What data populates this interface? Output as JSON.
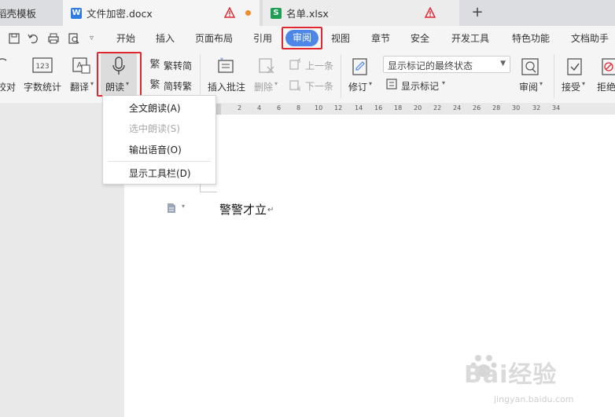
{
  "tabs": [
    {
      "label": "稻壳模板",
      "active": false
    },
    {
      "label": "文件加密.docx",
      "active": true,
      "icon": "W",
      "icon_color": "#2f7be6",
      "modified_dot_color": "#f08c2b"
    },
    {
      "label": "名单.xlsx",
      "active": false,
      "icon": "S",
      "icon_color": "#1f9f53"
    }
  ],
  "menu": {
    "items": [
      "开始",
      "插入",
      "页面布局",
      "引用",
      "审阅",
      "视图",
      "章节",
      "安全",
      "开发工具",
      "特色功能",
      "文档助手"
    ],
    "active": "审阅",
    "active_color": "#4c86e6"
  },
  "ribbon": {
    "proofread": "校对",
    "word_count": "字数统计",
    "translate": "翻译",
    "read_aloud": "朗读",
    "to_traditional": "繁转简",
    "to_simplified": "简转繁",
    "insert_comment": "插入批注",
    "delete": "删除",
    "prev": "上一条",
    "next": "下一条",
    "track_changes": "修订",
    "markup_state": "显示标记的最终状态",
    "show_markup": "显示标记",
    "review": "审阅",
    "accept": "接受",
    "reject": "拒绝"
  },
  "read_menu": {
    "items": [
      {
        "label": "全文朗读(A)",
        "enabled": true
      },
      {
        "label": "选中朗读(S)",
        "enabled": false
      },
      {
        "label": "输出语音(O)",
        "enabled": true
      },
      {
        "label": "显示工具栏(D)",
        "enabled": true
      }
    ]
  },
  "ruler": {
    "ticks": [
      "2",
      "4",
      "6",
      "8",
      "10",
      "12",
      "14",
      "16",
      "18",
      "20",
      "22",
      "24",
      "26",
      "28",
      "30",
      "32",
      "34"
    ]
  },
  "document": {
    "text": "警警才立"
  },
  "watermark": {
    "brand": "Bai经验",
    "url": "jingyan.baidu.com"
  },
  "highlight_color": "#e0262e"
}
